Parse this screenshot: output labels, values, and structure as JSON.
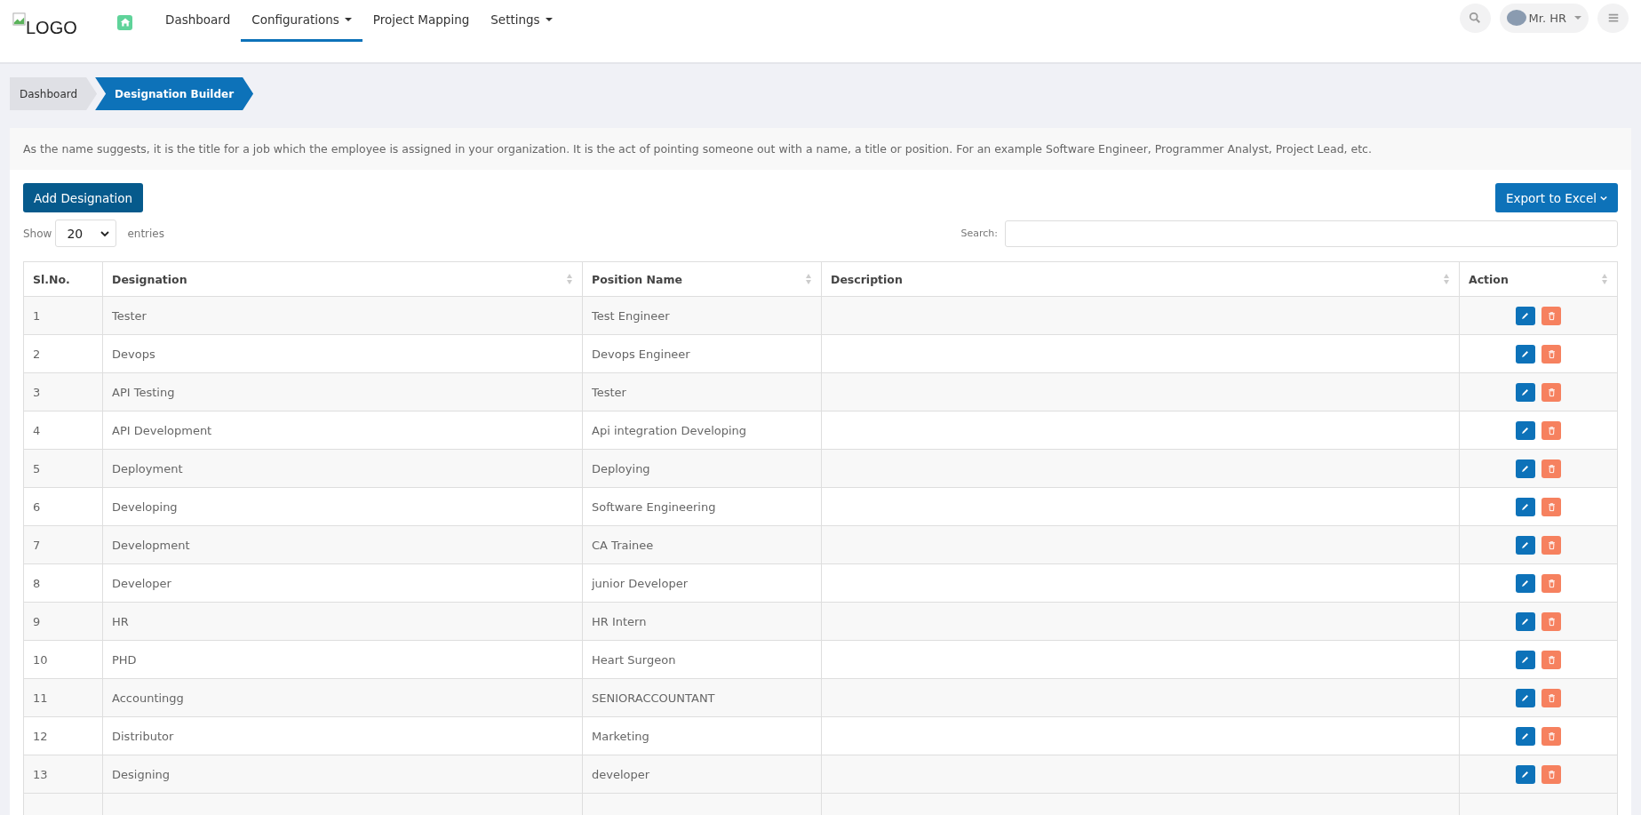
{
  "logo": {
    "alt_text": "LOGO"
  },
  "nav": [
    {
      "label": "Dashboard",
      "selected": false,
      "dropdown": false
    },
    {
      "label": "Configurations",
      "selected": true,
      "dropdown": true
    },
    {
      "label": "Project Mapping",
      "selected": false,
      "dropdown": false
    },
    {
      "label": "Settings",
      "selected": false,
      "dropdown": true
    }
  ],
  "user": {
    "name": "Mr. HR"
  },
  "breadcrumb": [
    {
      "label": "Dashboard",
      "selected": false
    },
    {
      "label": "Designation Builder",
      "selected": true
    }
  ],
  "description": "As the name suggests, it is the title for a job which the employee is assigned in your organization. It is the act of pointing someone out with a name, a title or position. For an example Software Engineer, Programmer Analyst, Project Lead, etc.",
  "add_button": "Add Designation",
  "export_button": "Export to Excel",
  "show_label": "Show",
  "page_size": "20",
  "entries_label": "entries",
  "search_label": "Search:",
  "table": {
    "columns": [
      {
        "label": "Sl.No.",
        "sortable": false
      },
      {
        "label": "Designation",
        "sortable": true
      },
      {
        "label": "Position Name",
        "sortable": true
      },
      {
        "label": "Description",
        "sortable": true
      },
      {
        "label": "Action",
        "sortable": true
      }
    ],
    "rows": [
      {
        "sl": "1",
        "designation": "Tester",
        "position": "Test Engineer"
      },
      {
        "sl": "2",
        "designation": "Devops",
        "position": "Devops Engineer"
      },
      {
        "sl": "3",
        "designation": "API Testing",
        "position": "Tester"
      },
      {
        "sl": "4",
        "designation": "API Development",
        "position": "Api integration Developing"
      },
      {
        "sl": "5",
        "designation": "Deployment",
        "position": "Deploying"
      },
      {
        "sl": "6",
        "designation": "Developing",
        "position": "Software Engineering"
      },
      {
        "sl": "7",
        "designation": "Development",
        "position": "CA Trainee"
      },
      {
        "sl": "8",
        "designation": "Developer",
        "position": "junior Developer"
      },
      {
        "sl": "9",
        "designation": "HR",
        "position": "HR Intern"
      },
      {
        "sl": "10",
        "designation": "PHD",
        "position": "Heart Surgeon"
      },
      {
        "sl": "11",
        "designation": "Accountingg",
        "position": "SENIORACCOUNTANT"
      },
      {
        "sl": "12",
        "designation": "Distributor",
        "position": "Marketing"
      },
      {
        "sl": "13",
        "designation": "Designing",
        "position": "developer"
      }
    ]
  }
}
